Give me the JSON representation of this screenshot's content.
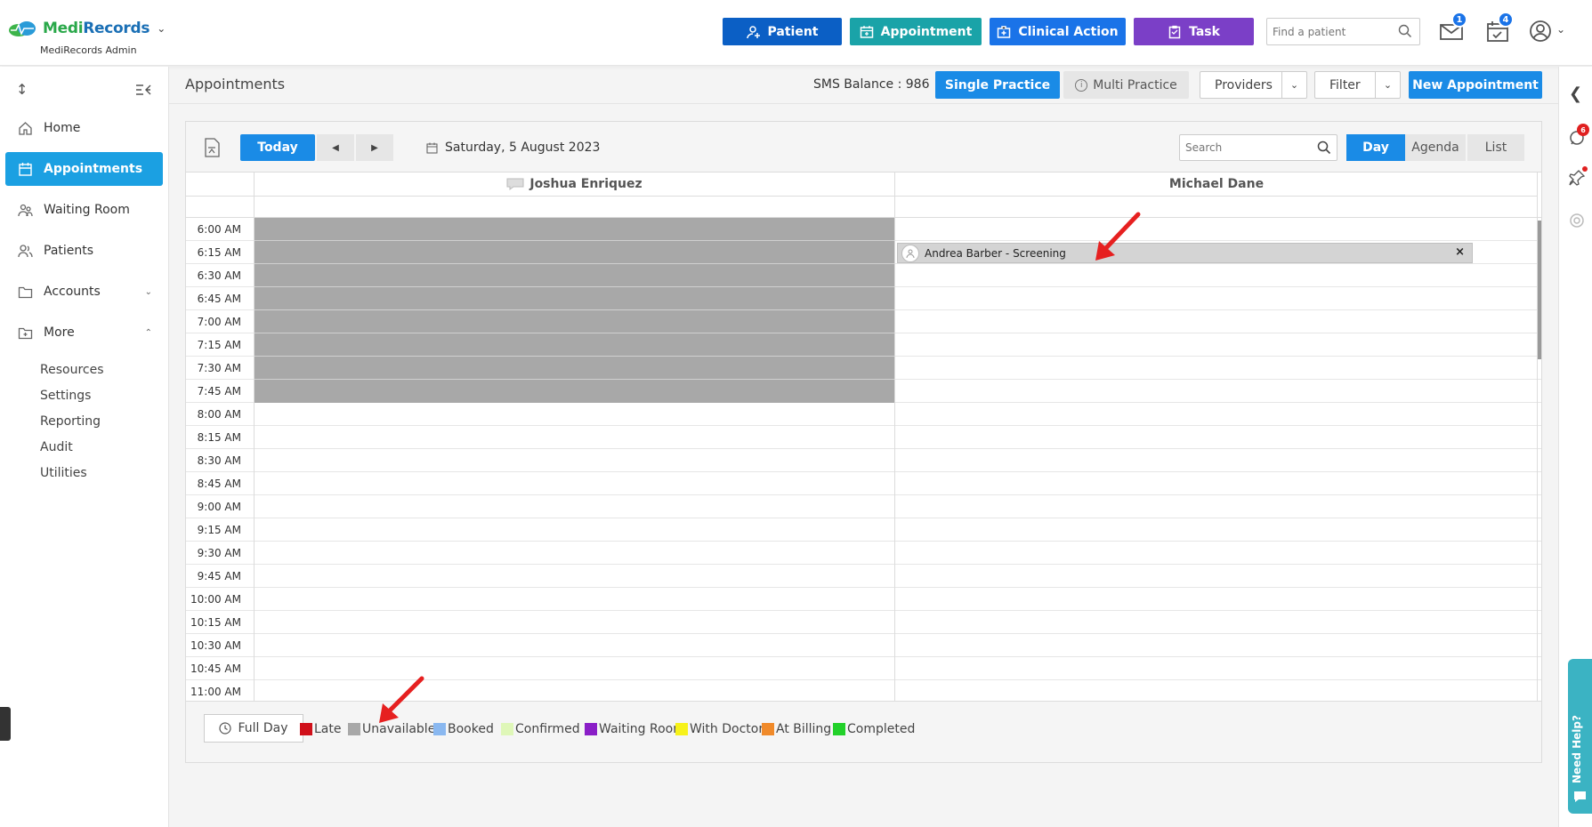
{
  "brand": {
    "name_part1": "Medi",
    "name_part2": "Records",
    "subtitle": "MediRecords Admin"
  },
  "header": {
    "buttons": [
      {
        "label": "Patient",
        "color": "#0b5fc5"
      },
      {
        "label": "Appointment",
        "color": "#1aa3a8"
      },
      {
        "label": "Clinical Action",
        "color": "#1a73e8"
      },
      {
        "label": "Task",
        "color": "#7b3fc7"
      }
    ],
    "find_placeholder": "Find a patient",
    "mail_badge": "1",
    "calendar_badge": "4"
  },
  "sidebar": {
    "items": [
      {
        "label": "Home",
        "icon": "home-icon"
      },
      {
        "label": "Appointments",
        "icon": "calendar-icon",
        "active": true
      },
      {
        "label": "Waiting Room",
        "icon": "people-icon"
      },
      {
        "label": "Patients",
        "icon": "patients-icon"
      },
      {
        "label": "Accounts",
        "icon": "folder-icon"
      },
      {
        "label": "More",
        "icon": "folder-plus-icon"
      }
    ],
    "sub_items": [
      "Resources",
      "Settings",
      "Reporting",
      "Audit",
      "Utilities"
    ]
  },
  "page": {
    "title": "Appointments",
    "sms_balance": "SMS Balance : 986",
    "single_practice": "Single Practice",
    "multi_practice": "Multi Practice",
    "providers": "Providers",
    "filter": "Filter",
    "new_appointment": "New Appointment"
  },
  "calendar": {
    "today": "Today",
    "date": "Saturday, 5 August 2023",
    "search_placeholder": "Search",
    "views": [
      "Day",
      "Agenda",
      "List"
    ],
    "providers": [
      "Joshua Enriquez",
      "Michael Dane"
    ],
    "times": [
      "6:00 AM",
      "6:15 AM",
      "6:30 AM",
      "6:45 AM",
      "7:00 AM",
      "7:15 AM",
      "7:30 AM",
      "7:45 AM",
      "8:00 AM",
      "8:15 AM",
      "8:30 AM",
      "8:45 AM",
      "9:00 AM",
      "9:15 AM",
      "9:30 AM",
      "9:45 AM",
      "10:00 AM",
      "10:15 AM",
      "10:30 AM",
      "10:45 AM",
      "11:00 AM"
    ],
    "appointment": {
      "label": "Andrea Barber - Screening",
      "close": "×"
    }
  },
  "legend": {
    "full_day": "Full Day",
    "items": [
      {
        "label": "Late",
        "color": "#d0101a"
      },
      {
        "label": "Unavailable",
        "color": "#a8a8a8"
      },
      {
        "label": "Booked",
        "color": "#8ab8f0"
      },
      {
        "label": "Confirmed",
        "color": "#dff7b8"
      },
      {
        "label": "Waiting Room",
        "color": "#8a1ec7"
      },
      {
        "label": "With Doctor",
        "color": "#f7f21a"
      },
      {
        "label": "At Billing",
        "color": "#f08a2a"
      },
      {
        "label": "Completed",
        "color": "#22d12a"
      }
    ]
  },
  "help": {
    "label": "Need Help?"
  },
  "rail": {
    "chat_badge": "6"
  }
}
